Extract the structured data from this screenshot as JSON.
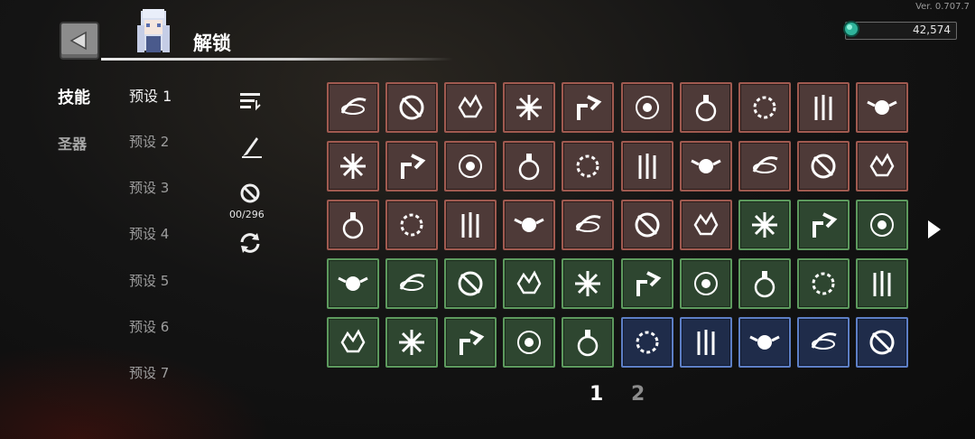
{
  "version": "Ver. 0.707.7",
  "header": {
    "title": "解锁"
  },
  "currency": {
    "value": "42,574",
    "icon": "gem-icon"
  },
  "categories": [
    {
      "label": "技能",
      "active": true
    },
    {
      "label": "圣器",
      "active": false
    }
  ],
  "presets": [
    {
      "label": "预设 1",
      "active": true
    },
    {
      "label": "预设 2"
    },
    {
      "label": "预设 3"
    },
    {
      "label": "预设 4"
    },
    {
      "label": "预设 5"
    },
    {
      "label": "预设 6"
    },
    {
      "label": "预设 7"
    }
  ],
  "tools": {
    "sort_icon": "sort-icon",
    "quill_icon": "quill-icon",
    "forbid_icon": "forbid-icon",
    "count": "00/296",
    "refresh_icon": "refresh-icon"
  },
  "grid": {
    "rows": [
      [
        "red",
        "red",
        "red",
        "red",
        "red",
        "red",
        "red",
        "red",
        "red",
        "red"
      ],
      [
        "red",
        "red",
        "red",
        "red",
        "red",
        "red",
        "red",
        "red",
        "red",
        "red"
      ],
      [
        "red",
        "red",
        "red",
        "red",
        "red",
        "red",
        "red",
        "green",
        "green",
        "green"
      ],
      [
        "green",
        "green",
        "green",
        "green",
        "green",
        "green",
        "green",
        "green",
        "green",
        "green"
      ],
      [
        "green",
        "green",
        "green",
        "green",
        "green",
        "blue",
        "blue",
        "blue",
        "blue",
        "blue"
      ]
    ],
    "icons": [
      [
        "slash-arc-icon",
        "spin-blade-icon",
        "thorn-burst-icon",
        "star-burst-icon",
        "arrow-split-icon",
        "rune-orb-icon",
        "potion-icon",
        "thorn-ring-icon",
        "triple-arrow-icon",
        "skull-wings-icon"
      ],
      [
        "moon-slash-icon",
        "feather-volley-icon",
        "mini-ufo-icon",
        "focus-point-icon",
        "frost-sword-icon",
        "vortex-icon",
        "target-orb-icon",
        "shard-spray-icon",
        "cloud-burst-icon",
        "gauntlet-icon"
      ],
      [
        "disc-spin-icon",
        "arrow-rain-icon",
        "storm-orb-icon",
        "claw-slash-icon",
        "spear-throw-icon",
        "cross-blade-icon",
        "pulse-wave-icon",
        "shard-fall-icon",
        "chain-star-icon",
        "lightning-fist-icon"
      ],
      [
        "totem-icon",
        "fire-ring-icon",
        "skull-blast-icon",
        "biohazard-icon",
        "blade-beam-icon",
        "flame-drop-icon",
        "crescent-orb-icon",
        "spike-rise-icon",
        "bat-ring-icon",
        "crack-star-icon"
      ],
      [
        "spark-dust-icon",
        "leaf-blade-icon",
        "shuriken-icon",
        "chain-ring-icon",
        "thunder-streak-icon",
        "triple-orb-icon",
        "lion-flame-icon",
        "hourglass-up-icon",
        "stair-up-icon",
        "stair-up-alt-icon"
      ]
    ]
  },
  "pagination": {
    "pages": [
      "1",
      "2"
    ],
    "current": "1"
  },
  "colors": {
    "red_slot": "#4e3a38",
    "green_slot": "#2e4630",
    "blue_slot": "#1f2c4a"
  }
}
